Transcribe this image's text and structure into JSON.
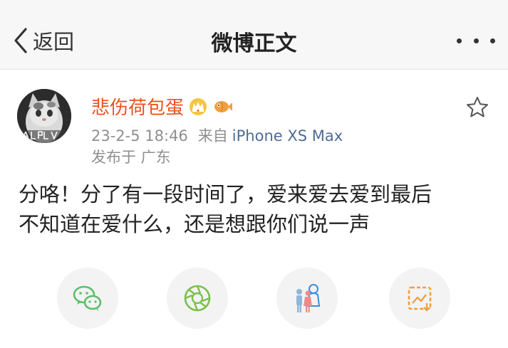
{
  "nav": {
    "back_label": "返回",
    "title": "微博正文"
  },
  "post": {
    "username": "悲伤荷包蛋",
    "time": "23-2-5 18:46",
    "from_label": "来自",
    "device": "iPhone XS Max",
    "location": "发布于 广东",
    "text_line1": "分咯！分了有一段时间了，爱来爱去爱到最后",
    "text_line2": "不知道在爱什么，还是想跟你们说一声"
  },
  "share": {
    "icons": [
      "wechat-icon",
      "moments-icon",
      "couple-sticker-icon",
      "image-edit-icon"
    ]
  },
  "colors": {
    "username": "#e8541e",
    "device_link": "#4f6b96",
    "wechat": "#5cbf6a",
    "moments": "#7ac04a",
    "accent_orange": "#f0a040"
  }
}
